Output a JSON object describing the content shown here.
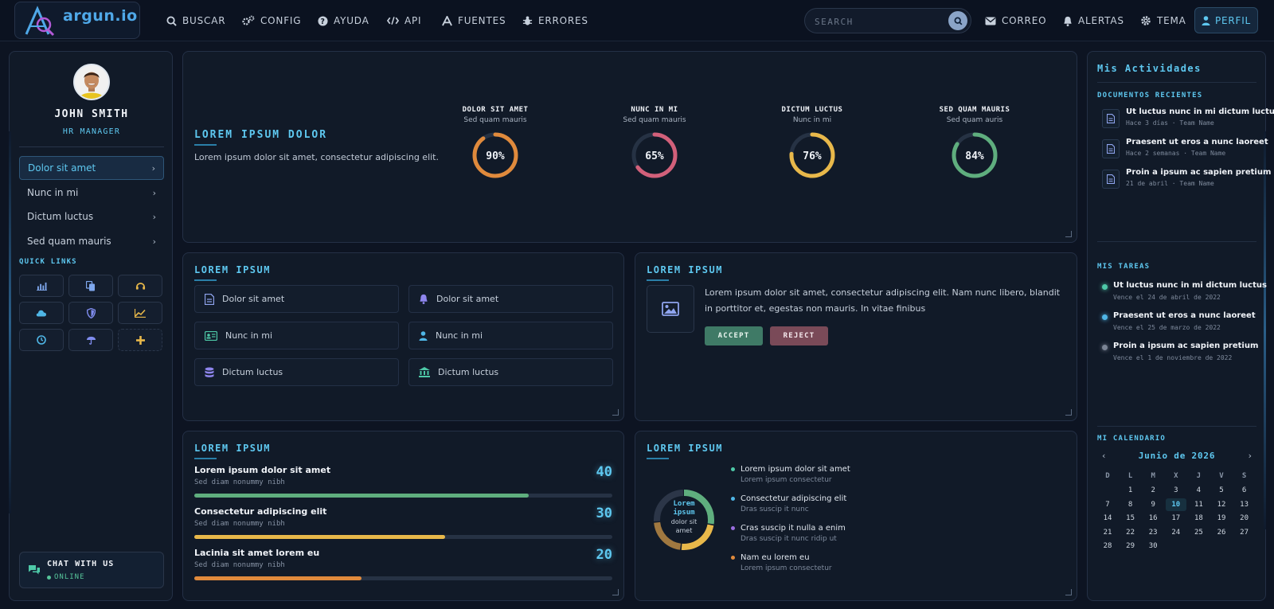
{
  "brand": {
    "name": "argun.io"
  },
  "nav": {
    "items": [
      {
        "label": "BUSCAR",
        "icon": "search-icon"
      },
      {
        "label": "CONFIG",
        "icon": "gears-icon"
      },
      {
        "label": "AYUDA",
        "icon": "help-icon"
      },
      {
        "label": "API",
        "icon": "code-icon"
      },
      {
        "label": "FUENTES",
        "icon": "font-icon"
      },
      {
        "label": "ERRORES",
        "icon": "bug-icon"
      }
    ],
    "search_placeholder": "SEARCH",
    "right_items": [
      {
        "label": "CORREO",
        "icon": "envelope-icon"
      },
      {
        "label": "ALERTAS",
        "icon": "bell-icon"
      },
      {
        "label": "TEMA",
        "icon": "gear-icon"
      }
    ],
    "profile_label": "PERFIL"
  },
  "sidebar": {
    "user_name": "JOHN SMITH",
    "user_role": "HR MANAGER",
    "menu": [
      {
        "label": "Dolor sit amet",
        "active": true
      },
      {
        "label": "Nunc in mi",
        "active": false
      },
      {
        "label": "Dictum luctus",
        "active": false
      },
      {
        "label": "Sed quam mauris",
        "active": false
      }
    ],
    "quick_links_title": "QUICK LINKS",
    "quick_links": [
      "bar-chart-icon",
      "copy-icon",
      "headset-icon",
      "cloud-icon",
      "shield-icon",
      "line-chart-icon",
      "clock-icon",
      "umbrella-icon",
      "plus-icon"
    ],
    "chat_title": "CHAT WITH US",
    "chat_status": "ONLINE"
  },
  "stats": {
    "heading": "LOREM IPSUM DOLOR",
    "description": "Lorem ipsum dolor sit amet, consectetur adipiscing elit.",
    "gauges": [
      {
        "title": "DOLOR SIT AMET",
        "subtitle": "Sed quam mauris",
        "value": 90,
        "label": "90%",
        "color": "#e08a3c"
      },
      {
        "title": "NUNC IN MI",
        "subtitle": "Sed quam mauris",
        "value": 65,
        "label": "65%",
        "color": "#d2607a"
      },
      {
        "title": "DICTUM LUCTUS",
        "subtitle": "Nunc in mi",
        "value": 76,
        "label": "76%",
        "color": "#e8b84a"
      },
      {
        "title": "SED QUAM MAURIS",
        "subtitle": "Sed quam auris",
        "value": 84,
        "label": "84%",
        "color": "#5fae7e"
      }
    ]
  },
  "nav_card": {
    "title": "LOREM IPSUM",
    "tiles": [
      {
        "label": "Dolor sit amet",
        "icon": "file-icon"
      },
      {
        "label": "Dolor sit amet",
        "icon": "bell-icon"
      },
      {
        "label": "Nunc in mi",
        "icon": "id-card-icon"
      },
      {
        "label": "Nunc in mi",
        "icon": "user-icon"
      },
      {
        "label": "Dictum luctus",
        "icon": "database-icon"
      },
      {
        "label": "Dictum luctus",
        "icon": "bank-icon"
      }
    ]
  },
  "msg_card": {
    "title": "LOREM IPSUM",
    "text": "Lorem ipsum dolor sit amet, consectetur adipiscing elit. Nam nunc libero, blandit in porttitor et, egestas non mauris. In vitae finibus",
    "accept_label": "ACCEPT",
    "reject_label": "REJECT"
  },
  "progress_card": {
    "title": "LOREM IPSUM",
    "rows": [
      {
        "title": "Lorem ipsum dolor sit amet",
        "subtitle": "Sed diam nonummy nibh",
        "value": "40",
        "fill": 0.8,
        "color": "#5fae7e"
      },
      {
        "title": "Consectetur adipiscing elit",
        "subtitle": "Sed diam nonummy nibh",
        "value": "30",
        "fill": 0.6,
        "color": "#e8b84a"
      },
      {
        "title": "Lacinia sit amet lorem eu",
        "subtitle": "Sed diam nonummy nibh",
        "value": "20",
        "fill": 0.4,
        "color": "#e08a3c"
      }
    ]
  },
  "donut_card": {
    "title": "LOREM IPSUM",
    "center_title": "Lorem ipsum",
    "center_sub": "dolor sit amet",
    "segments": [
      {
        "value": 28,
        "color": "#5fae7e"
      },
      {
        "value": 24,
        "color": "#e8b84a"
      },
      {
        "value": 22,
        "color": "#a07840"
      },
      {
        "value": 26,
        "color": "#2c3648"
      }
    ],
    "legend": [
      {
        "title": "Lorem ipsum dolor sit amet",
        "subtitle": "Lorem ipsum consectetur",
        "color": "#4ec9a8"
      },
      {
        "title": "Consectetur adipiscing elit",
        "subtitle": "Dras suscip it nunc",
        "color": "#4fb6e6"
      },
      {
        "title": "Cras suscip it nulla a enim",
        "subtitle": "Dras suscip it nunc ridip ut",
        "color": "#9a6ee0"
      },
      {
        "title": "Nam eu lorem eu",
        "subtitle": "Lorem ipsum consectetur",
        "color": "#e08a3c"
      }
    ]
  },
  "right": {
    "title": "Mis Actividades",
    "docs_title": "DOCUMENTOS RECIENTES",
    "docs": [
      {
        "title": "Ut luctus nunc in mi dictum luctus",
        "subtitle": "Hace 3 días · Team Name"
      },
      {
        "title": "Praesent ut eros a nunc laoreet",
        "subtitle": "Hace 2 semanas · Team Name"
      },
      {
        "title": "Proin a ipsum ac sapien pretium",
        "subtitle": "21 de abril · Team Name"
      }
    ],
    "tasks_title": "MIS TAREAS",
    "tasks": [
      {
        "title": "Ut luctus nunc in mi dictum luctus",
        "subtitle": "Vence el 24 de abril de 2022",
        "color": "#4ec9a8"
      },
      {
        "title": "Praesent ut eros a nunc laoreet",
        "subtitle": "Vence el 25 de marzo de 2022",
        "color": "#4fb6e6"
      },
      {
        "title": "Proin a ipsum ac sapien pretium",
        "subtitle": "Vence el 1 de noviembre de 2022",
        "color": "#7a8494"
      }
    ],
    "calendar_title": "MI CALENDARIO",
    "calendar_month": "Junio de 2026",
    "weekdays": [
      "D",
      "L",
      "M",
      "X",
      "J",
      "V",
      "S"
    ],
    "weeks": [
      [
        "",
        "1",
        "2",
        "3",
        "4",
        "5",
        "6"
      ],
      [
        "7",
        "8",
        "9",
        "10",
        "11",
        "12",
        "13"
      ],
      [
        "14",
        "15",
        "16",
        "17",
        "18",
        "19",
        "20"
      ],
      [
        "21",
        "22",
        "23",
        "24",
        "25",
        "26",
        "27"
      ],
      [
        "28",
        "29",
        "30",
        "",
        "",
        "",
        ""
      ]
    ],
    "today": "10"
  }
}
